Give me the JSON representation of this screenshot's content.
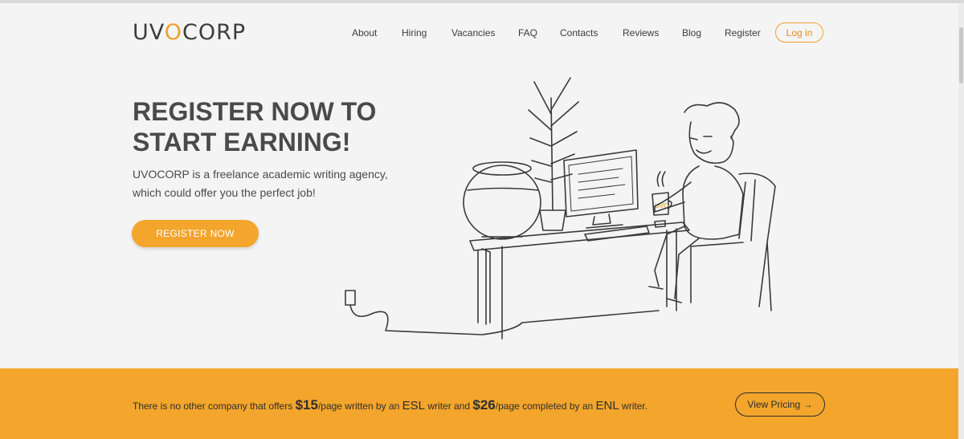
{
  "brand": {
    "logo_prefix": "UV",
    "logo_o": "O",
    "logo_suffix": "CORP"
  },
  "nav": {
    "items": [
      {
        "label": "About"
      },
      {
        "label": "Hiring"
      },
      {
        "label": "Vacancies"
      },
      {
        "label": "FAQ"
      },
      {
        "label": "Contacts"
      },
      {
        "label": "Reviews"
      },
      {
        "label": "Blog"
      },
      {
        "label": "Register"
      }
    ],
    "login_label": "Log in"
  },
  "hero": {
    "title_line1": "REGISTER NOW TO",
    "title_line2": "START EARNING!",
    "description": "UVOCORP is a freelance academic writing agency, which could offer you the perfect job!",
    "cta_label": "REGISTER NOW",
    "mug_text": "UVO"
  },
  "banner": {
    "t1": "There is no other company that offers ",
    "price1": "$15",
    "t2": "/page written by an ",
    "esl": "ESL",
    "t3": " writer and ",
    "price2": "$26",
    "t4": "/page completed by an ",
    "enl": "ENL",
    "t5": " writer.",
    "pricing_label": "View Pricing →"
  },
  "colors": {
    "accent": "#f3a52c",
    "text": "#454545",
    "background": "#f4f4f5"
  }
}
